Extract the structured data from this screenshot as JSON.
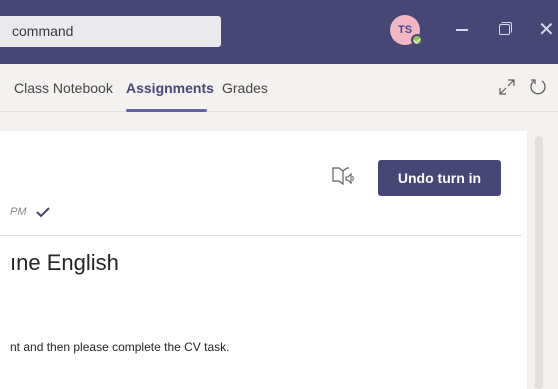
{
  "titlebar": {
    "search_value": "command",
    "avatar_initials": "TS",
    "presence_color": "#92c353",
    "window_controls": [
      "minimize-icon",
      "maximize-icon",
      "close-icon"
    ]
  },
  "tabs": {
    "items": [
      {
        "label": "Class Notebook",
        "active": false
      },
      {
        "label": "Assignments",
        "active": true
      },
      {
        "label": "Grades",
        "active": false
      }
    ],
    "icons": [
      "expand-icon",
      "refresh-icon"
    ]
  },
  "assignment": {
    "time_suffix": "PM",
    "status_icon": "checkmark-icon",
    "undo_label": "Undo turn in",
    "title_fragment": "ıne English",
    "instructions_fragment": "nt and then please complete the CV task."
  },
  "colors": {
    "brand": "#464775",
    "accent": "#6264a7"
  }
}
